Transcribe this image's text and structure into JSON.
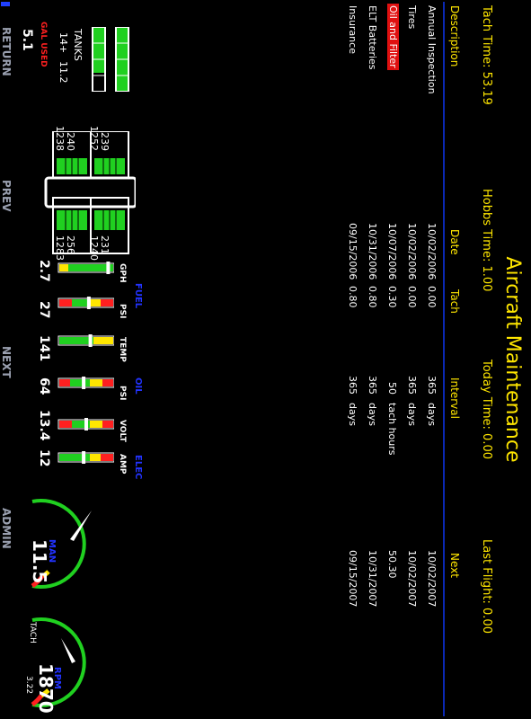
{
  "header": {
    "title": "Aircraft Maintenance",
    "tach_time": "Tach Time: 53.19",
    "hobbs_time": "Hobbs Time: 1.00",
    "today_time": "Today Time: 0.00",
    "last_flight": "Last Flight: 0.00"
  },
  "table": {
    "columns": [
      "Description",
      "Date",
      "Tach",
      "Interval",
      "Next"
    ],
    "rows": [
      {
        "description": "Annual Inspection",
        "date": "10/02/2006",
        "tach": "0.00",
        "interval_val": "365",
        "interval_unit": "days",
        "next": "10/02/2007",
        "overdue": false
      },
      {
        "description": "Tires",
        "date": "10/02/2006",
        "tach": "0.00",
        "interval_val": "365",
        "interval_unit": "days",
        "next": "10/02/2007",
        "overdue": false
      },
      {
        "description": "Oil and Filter",
        "date": "10/07/2006",
        "tach": "0.30",
        "interval_val": "50",
        "interval_unit": "tach hours",
        "next": "50.30",
        "overdue": true
      },
      {
        "description": "ELT Batteries",
        "date": "10/31/2006",
        "tach": "0.80",
        "interval_val": "365",
        "interval_unit": "days",
        "next": "10/31/2007",
        "overdue": false
      },
      {
        "description": "Insurance",
        "date": "09/15/2006",
        "tach": "0.80",
        "interval_val": "365",
        "interval_unit": "days",
        "next": "09/15/2007",
        "overdue": false
      }
    ]
  },
  "tanks": {
    "label": "TANKS",
    "left": "14+",
    "right": "11.2",
    "gal_used_label": "GAL USED",
    "gal_used": "5.1"
  },
  "egt_cht": {
    "top_left": [
      "239",
      "1252"
    ],
    "bottom_left": [
      "240",
      "1238"
    ],
    "top_right": [
      "231",
      "1240"
    ],
    "bottom_right": [
      "256",
      "1283"
    ]
  },
  "sections": {
    "fuel": "FUEL",
    "oil": "OIL",
    "elec": "ELEC"
  },
  "bar_gauges": [
    {
      "label": "GPH",
      "value": "2.7",
      "level": 0.08
    },
    {
      "label": "PSI",
      "value": "27",
      "level": 0.45
    },
    {
      "label": "TEMP",
      "value": "141",
      "level": 0.42
    },
    {
      "label": "PSI",
      "value": "64",
      "level": 0.55
    },
    {
      "label": "VOLT",
      "value": "13.4",
      "level": 0.5
    },
    {
      "label": "AMP",
      "value": "12",
      "level": 0.55
    }
  ],
  "man": {
    "value": "11.5",
    "label": "MAN"
  },
  "rpm": {
    "value": "1870",
    "label": "RPM",
    "tach_label": "TACH",
    "tach_value": "3.22"
  },
  "buttons": {
    "return": "RETURN",
    "prev": "PREV",
    "next": "NEXT",
    "admin": "ADMIN"
  },
  "colors": {
    "accent_yellow": "#ffe600",
    "alert_red": "#ff2020",
    "label_blue": "#2233ff",
    "gauge_green": "#20d020",
    "separator": "#0a28b4"
  }
}
